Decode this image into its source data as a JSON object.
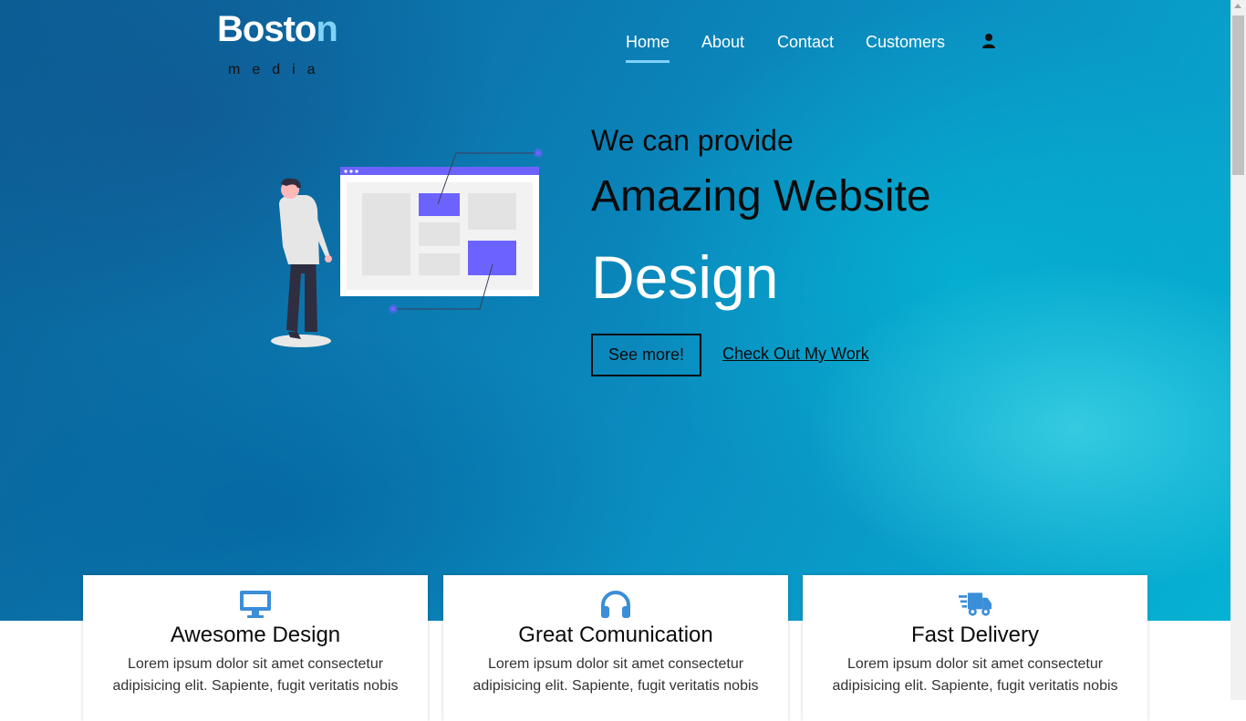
{
  "brand": {
    "name_main": "Bosto",
    "name_highlight": "n",
    "subtitle": "media"
  },
  "nav": {
    "items": [
      {
        "label": "Home",
        "active": true
      },
      {
        "label": "About",
        "active": false
      },
      {
        "label": "Contact",
        "active": false
      },
      {
        "label": "Customers",
        "active": false
      }
    ],
    "user_icon": "user-icon"
  },
  "hero": {
    "tagline_1": "We can provide",
    "tagline_2": "Amazing Website",
    "tagline_3": "Design",
    "primary_button": "See more!",
    "secondary_link": "Check Out My Work"
  },
  "features": [
    {
      "icon": "monitor-icon",
      "title": "Awesome Design",
      "text": "Lorem ipsum dolor sit amet consectetur adipisicing elit. Sapiente, fugit veritatis nobis"
    },
    {
      "icon": "headphones-icon",
      "title": "Great Comunication",
      "text": "Lorem ipsum dolor sit amet consectetur adipisicing elit. Sapiente, fugit veritatis nobis"
    },
    {
      "icon": "truck-icon",
      "title": "Fast Delivery",
      "text": "Lorem ipsum dolor sit amet consectetur adipisicing elit. Sapiente, fugit veritatis nobis"
    }
  ],
  "colors": {
    "accent": "#3b8ed8",
    "illustration": "#6c63ff",
    "nav_underline": "#7fd3f7"
  }
}
